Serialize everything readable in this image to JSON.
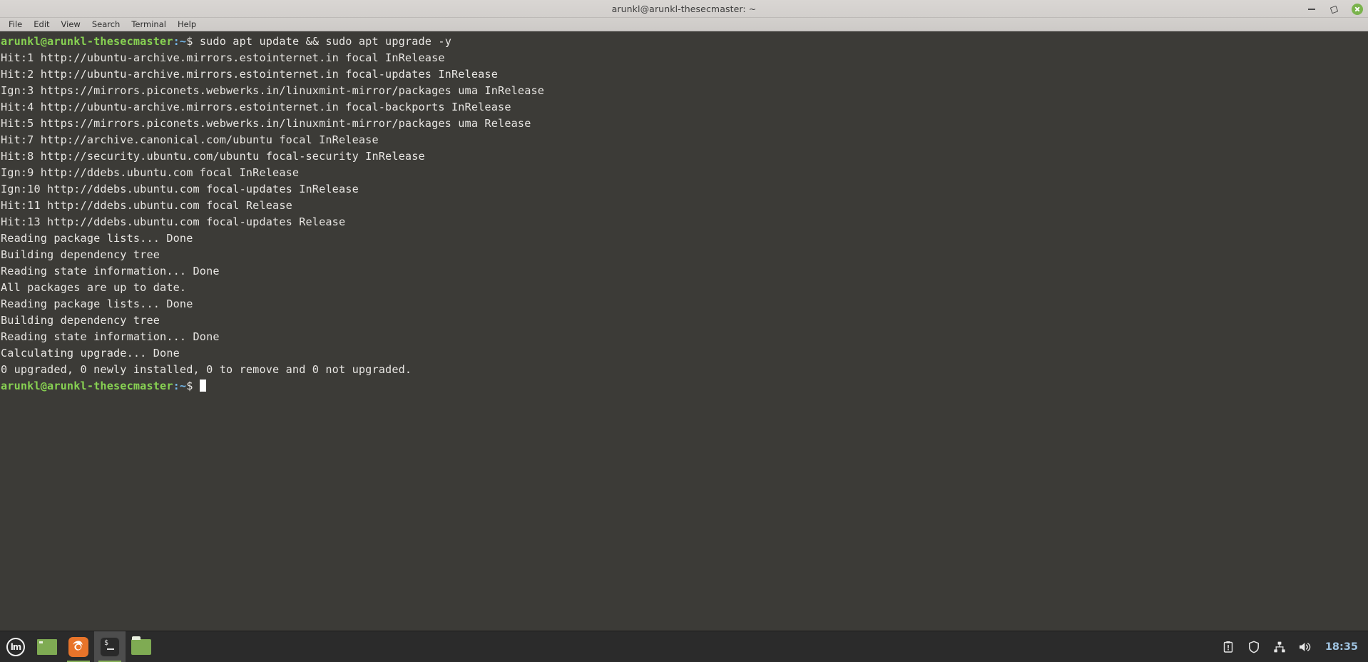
{
  "window": {
    "title": "arunkl@arunkl-thesecmaster: ~",
    "controls": {
      "minimize": "minimize",
      "maximize": "restore",
      "close": "close"
    }
  },
  "menubar": {
    "items": [
      {
        "label": "File"
      },
      {
        "label": "Edit"
      },
      {
        "label": "View"
      },
      {
        "label": "Search"
      },
      {
        "label": "Terminal"
      },
      {
        "label": "Help"
      }
    ]
  },
  "terminal": {
    "prompt": {
      "user_host": "arunkl@arunkl-thesecmaster",
      "path": ":~",
      "dollar": "$ "
    },
    "command": "sudo apt update && sudo apt upgrade -y",
    "output": [
      "Hit:1 http://ubuntu-archive.mirrors.estointernet.in focal InRelease",
      "Hit:2 http://ubuntu-archive.mirrors.estointernet.in focal-updates InRelease",
      "Ign:3 https://mirrors.piconets.webwerks.in/linuxmint-mirror/packages uma InRelease",
      "Hit:4 http://ubuntu-archive.mirrors.estointernet.in focal-backports InRelease",
      "Hit:5 https://mirrors.piconets.webwerks.in/linuxmint-mirror/packages uma Release",
      "Hit:7 http://archive.canonical.com/ubuntu focal InRelease",
      "Hit:8 http://security.ubuntu.com/ubuntu focal-security InRelease",
      "Ign:9 http://ddebs.ubuntu.com focal InRelease",
      "Ign:10 http://ddebs.ubuntu.com focal-updates InRelease",
      "Hit:11 http://ddebs.ubuntu.com focal Release",
      "Hit:13 http://ddebs.ubuntu.com focal-updates Release",
      "Reading package lists... Done",
      "Building dependency tree",
      "Reading state information... Done",
      "All packages are up to date.",
      "Reading package lists... Done",
      "Building dependency tree",
      "Reading state information... Done",
      "Calculating upgrade... Done",
      "0 upgraded, 0 newly installed, 0 to remove and 0 not upgraded."
    ]
  },
  "panel": {
    "menu_button": {
      "label": "lm",
      "name": "linux-mint-menu"
    },
    "tasks": [
      {
        "name": "window-list-item",
        "icon": "window-icon",
        "active": false,
        "running": false
      },
      {
        "name": "firefox",
        "icon": "firefox-icon",
        "active": false,
        "running": true
      },
      {
        "name": "terminal",
        "icon": "terminal-icon",
        "active": true,
        "running": true
      },
      {
        "name": "files",
        "icon": "folder-icon",
        "active": false,
        "running": false
      }
    ],
    "tray": [
      {
        "name": "update-manager-icon"
      },
      {
        "name": "firewall-shield-icon"
      },
      {
        "name": "network-icon"
      },
      {
        "name": "volume-icon"
      }
    ],
    "clock": "18:35"
  },
  "colors": {
    "titlebar_bg": "#d6d3d0",
    "terminal_bg": "#3c3b37",
    "terminal_fg": "#e8e6e3",
    "prompt_green": "#87d152",
    "prompt_blue": "#73b6e8",
    "panel_bg": "#2b2b2b",
    "clock_blue": "#9fc3e0",
    "close_green": "#7ab34c"
  }
}
